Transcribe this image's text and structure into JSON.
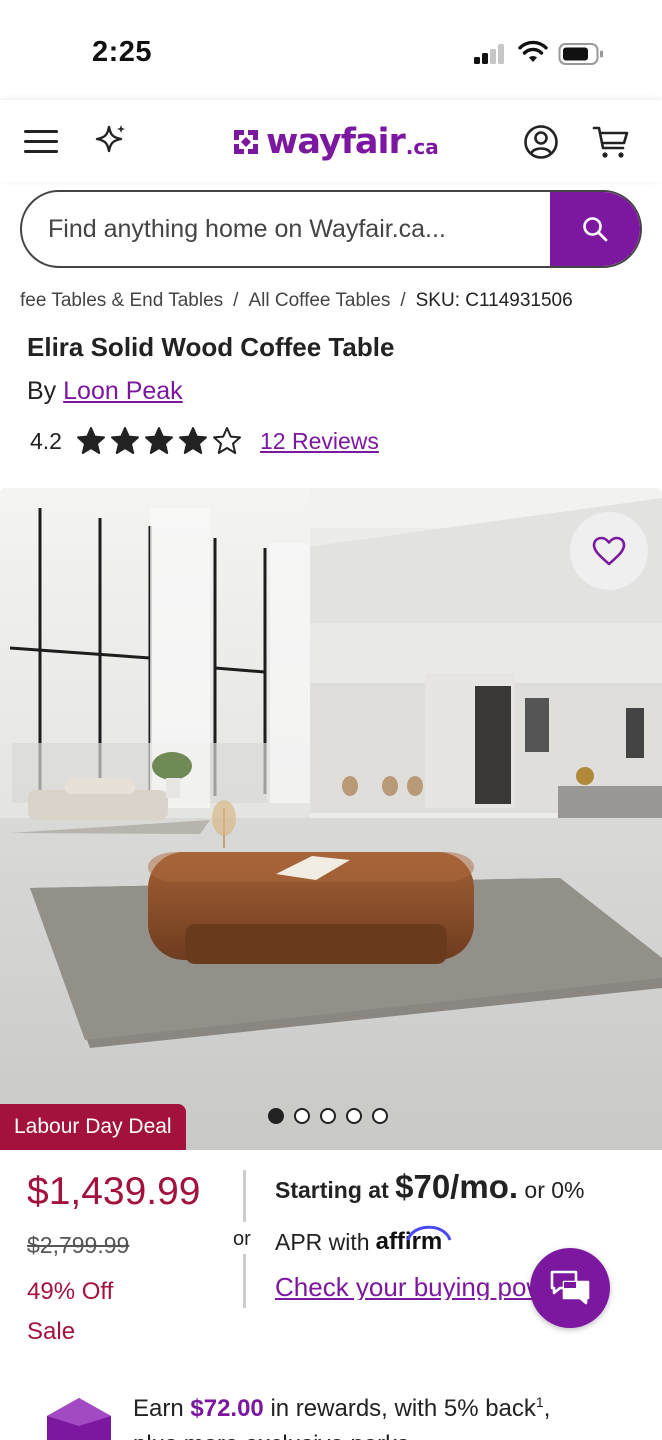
{
  "status_bar": {
    "time": "2:25"
  },
  "header": {
    "logo_text": "wayfair",
    "logo_suffix": ".ca",
    "brand_color": "#7b189f"
  },
  "search": {
    "placeholder": "Find anything home on Wayfair.ca..."
  },
  "breadcrumb": {
    "items": [
      "fee Tables & End Tables",
      "All Coffee Tables",
      "SKU: C114931506"
    ],
    "separator": "/"
  },
  "product": {
    "title": "Elira Solid Wood Coffee Table",
    "by_prefix": "By",
    "brand": "Loon Peak",
    "rating": "4.2",
    "rating_stars": 4.2,
    "reviews_label": "12 Reviews"
  },
  "gallery": {
    "deal_badge": "Labour Day Deal",
    "slide_count": 5,
    "active_slide": 1
  },
  "pricing": {
    "price": "$1,439.99",
    "was_price": "$2,799.99",
    "discount": "49% Off",
    "sale_label": "Sale",
    "sale_color": "#a3123c"
  },
  "financing": {
    "or": "or",
    "starting_at": "Starting at",
    "monthly": "$70/mo.",
    "apr_prefix": "or 0%",
    "apr_line": "APR with",
    "affirm": "affirm",
    "link": "Check your buying power"
  },
  "rewards": {
    "prefix": "Earn",
    "amount": "$72.00",
    "suffix": "in rewards, with 5% back",
    "footnote": "1",
    "line2": "plus more exclusive perks"
  },
  "icons": {
    "menu": "hamburger-menu-icon",
    "assistant": "sparkle-icon",
    "account": "account-icon",
    "cart": "cart-icon",
    "search": "search-icon",
    "favorite": "heart-icon",
    "chat": "chat-icon"
  }
}
